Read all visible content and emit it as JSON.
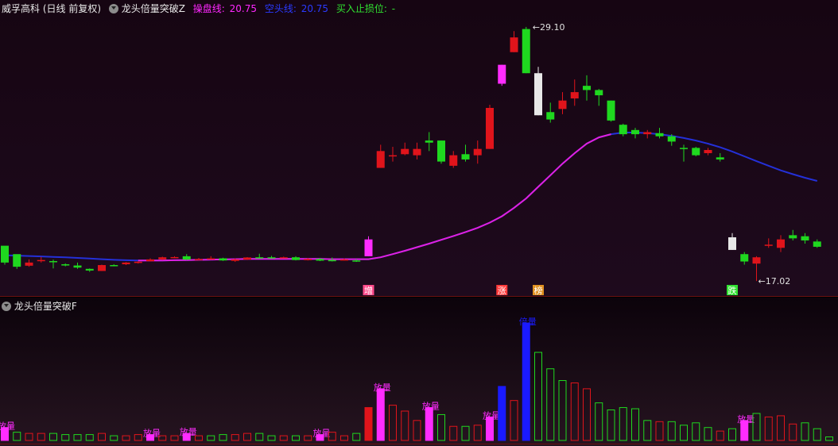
{
  "header": {
    "stock_name": "威孚高科",
    "period": "(日线 前复权)",
    "indicator_name": "龙头倍量突破Z",
    "control_label": "操盘线:",
    "control_value": "20.75",
    "empty_label": "空头线:",
    "empty_value": "20.75",
    "stop_label": "买入止损位:",
    "stop_value": "-"
  },
  "sub_header": {
    "indicator_name": "龙头倍量突破F"
  },
  "colors": {
    "up": "#e0141b",
    "down": "#1fd81f",
    "ma_blue": "#2430d8",
    "ma_magenta": "#e020e0",
    "special_magenta": "#ff2cff",
    "special_white": "#e8e8e8",
    "special_blue": "#1a1aff",
    "price_label": "#e0e0e0"
  },
  "chart_data": [
    {
      "type": "candlestick",
      "high_label": "29.10",
      "low_label": "17.02",
      "signals": [
        {
          "index": 30,
          "text": "增"
        },
        {
          "index": 41,
          "text": "涨"
        },
        {
          "index": 44,
          "text": "榜"
        },
        {
          "index": 60,
          "text": "跌"
        }
      ],
      "candles": [
        {
          "o": 17.9,
          "h": 18.2,
          "c": 18.7,
          "l": 17.8,
          "k": "g"
        },
        {
          "o": 17.7,
          "h": 18.1,
          "c": 18.3,
          "l": 17.6,
          "k": "g"
        },
        {
          "o": 17.9,
          "h": 18.05,
          "c": 17.75,
          "l": 17.7,
          "k": "r"
        },
        {
          "o": 17.97,
          "h": 18.17,
          "c": 18.02,
          "l": 17.9,
          "k": "r"
        },
        {
          "o": 17.92,
          "h": 18.04,
          "c": 17.97,
          "l": 17.62,
          "k": "g"
        },
        {
          "o": 17.76,
          "h": 17.86,
          "c": 17.82,
          "l": 17.72,
          "k": "g"
        },
        {
          "o": 17.76,
          "h": 17.9,
          "c": 17.66,
          "l": 17.6,
          "k": "g"
        },
        {
          "o": 17.6,
          "h": 17.62,
          "c": 17.52,
          "l": 17.46,
          "k": "g"
        },
        {
          "o": 17.5,
          "h": 17.8,
          "c": 17.78,
          "l": 17.5,
          "k": "r"
        },
        {
          "o": 17.78,
          "h": 17.82,
          "c": 17.75,
          "l": 17.72,
          "k": "g"
        },
        {
          "o": 17.82,
          "h": 17.92,
          "c": 17.9,
          "l": 17.78,
          "k": "r"
        },
        {
          "o": 17.88,
          "h": 17.96,
          "c": 17.94,
          "l": 17.85,
          "k": "r"
        },
        {
          "o": 17.96,
          "h": 18.1,
          "c": 18.05,
          "l": 17.95,
          "k": "r"
        },
        {
          "o": 18.05,
          "h": 18.18,
          "c": 18.15,
          "l": 18.02,
          "k": "r"
        },
        {
          "o": 18.14,
          "h": 18.2,
          "c": 18.16,
          "l": 18.1,
          "k": "r"
        },
        {
          "o": 18.2,
          "h": 18.3,
          "c": 18.04,
          "l": 18.02,
          "k": "g"
        },
        {
          "o": 18.05,
          "h": 18.12,
          "c": 18.07,
          "l": 18.0,
          "k": "r"
        },
        {
          "o": 18.06,
          "h": 18.2,
          "c": 18.1,
          "l": 18.03,
          "k": "r"
        },
        {
          "o": 18.1,
          "h": 18.13,
          "c": 18.0,
          "l": 17.98,
          "k": "g"
        },
        {
          "o": 17.98,
          "h": 18.1,
          "c": 18.05,
          "l": 17.93,
          "k": "r"
        },
        {
          "o": 18.04,
          "h": 18.16,
          "c": 18.14,
          "l": 18.02,
          "k": "r"
        },
        {
          "o": 18.15,
          "h": 18.32,
          "c": 18.12,
          "l": 18.1,
          "k": "g"
        },
        {
          "o": 18.14,
          "h": 18.22,
          "c": 18.15,
          "l": 18.1,
          "k": "g"
        },
        {
          "o": 18.15,
          "h": 18.18,
          "c": 18.13,
          "l": 18.1,
          "k": "r"
        },
        {
          "o": 18.15,
          "h": 18.2,
          "c": 18.02,
          "l": 18.0,
          "k": "g"
        },
        {
          "o": 18.05,
          "h": 18.12,
          "c": 18.07,
          "l": 18.0,
          "k": "r"
        },
        {
          "o": 18.07,
          "h": 18.12,
          "c": 17.99,
          "l": 17.97,
          "k": "g"
        },
        {
          "o": 18.0,
          "h": 18.14,
          "c": 18.02,
          "l": 17.95,
          "k": "g"
        },
        {
          "o": 18.04,
          "h": 18.1,
          "c": 18.05,
          "l": 18.0,
          "k": "r"
        },
        {
          "o": 18.0,
          "h": 18.06,
          "c": 17.95,
          "l": 17.93,
          "k": "g"
        },
        {
          "o": 18.2,
          "h": 19.15,
          "c": 19.0,
          "l": 18.2,
          "k": "m"
        },
        {
          "o": 22.4,
          "h": 23.5,
          "c": 23.2,
          "l": 22.4,
          "k": "r"
        },
        {
          "o": 23.0,
          "h": 23.4,
          "c": 22.95,
          "l": 22.7,
          "k": "r"
        },
        {
          "o": 23.05,
          "h": 23.6,
          "c": 23.3,
          "l": 23.0,
          "k": "r"
        },
        {
          "o": 23.0,
          "h": 23.6,
          "c": 23.3,
          "l": 22.8,
          "k": "r"
        },
        {
          "o": 23.7,
          "h": 24.1,
          "c": 23.6,
          "l": 23.2,
          "k": "g"
        },
        {
          "o": 23.7,
          "h": 23.7,
          "c": 22.7,
          "l": 22.6,
          "k": "g"
        },
        {
          "o": 22.5,
          "h": 23.2,
          "c": 23.0,
          "l": 22.4,
          "k": "r"
        },
        {
          "o": 23.05,
          "h": 23.5,
          "c": 22.8,
          "l": 22.7,
          "k": "g"
        },
        {
          "o": 23.0,
          "h": 23.7,
          "c": 23.3,
          "l": 22.6,
          "k": "r"
        },
        {
          "o": 23.3,
          "h": 25.4,
          "c": 25.25,
          "l": 23.3,
          "k": "r"
        },
        {
          "o": 26.4,
          "h": 27.3,
          "c": 27.3,
          "l": 26.3,
          "k": "m"
        },
        {
          "o": 27.9,
          "h": 28.9,
          "c": 28.6,
          "l": 27.9,
          "k": "r"
        },
        {
          "o": 29.0,
          "h": 29.1,
          "c": 26.9,
          "l": 26.9,
          "k": "g"
        },
        {
          "o": 26.9,
          "h": 27.2,
          "c": 24.9,
          "l": 24.9,
          "k": "w"
        },
        {
          "o": 25.05,
          "h": 25.5,
          "c": 24.7,
          "l": 24.55,
          "k": "g"
        },
        {
          "o": 25.2,
          "h": 26.0,
          "c": 25.6,
          "l": 24.95,
          "k": "r"
        },
        {
          "o": 25.7,
          "h": 26.6,
          "c": 26.0,
          "l": 25.35,
          "k": "r"
        },
        {
          "o": 26.3,
          "h": 26.8,
          "c": 26.1,
          "l": 25.6,
          "k": "g"
        },
        {
          "o": 26.1,
          "h": 26.15,
          "c": 25.85,
          "l": 25.35,
          "k": "g"
        },
        {
          "o": 25.6,
          "h": 25.6,
          "c": 24.65,
          "l": 24.6,
          "k": "g"
        },
        {
          "o": 24.45,
          "h": 24.5,
          "c": 24.0,
          "l": 23.9,
          "k": "g"
        },
        {
          "o": 24.2,
          "h": 24.3,
          "c": 24.0,
          "l": 23.8,
          "k": "g"
        },
        {
          "o": 24.0,
          "h": 24.2,
          "c": 24.1,
          "l": 23.8,
          "k": "r"
        },
        {
          "o": 24.05,
          "h": 24.3,
          "c": 23.9,
          "l": 23.8,
          "k": "g"
        },
        {
          "o": 23.9,
          "h": 24.0,
          "c": 23.65,
          "l": 23.45,
          "k": "g"
        },
        {
          "o": 23.35,
          "h": 23.5,
          "c": 23.3,
          "l": 22.7,
          "k": "g"
        },
        {
          "o": 23.35,
          "h": 23.4,
          "c": 23.0,
          "l": 22.95,
          "k": "g"
        },
        {
          "o": 23.1,
          "h": 23.35,
          "c": 23.25,
          "l": 23.0,
          "k": "r"
        },
        {
          "o": 22.9,
          "h": 23.1,
          "c": 22.8,
          "l": 22.7,
          "k": "g"
        },
        {
          "o": 19.1,
          "h": 19.3,
          "c": 18.5,
          "l": 18.5,
          "k": "w"
        },
        {
          "o": 18.3,
          "h": 18.4,
          "c": 17.95,
          "l": 17.8,
          "k": "g"
        },
        {
          "o": 17.85,
          "h": 18.2,
          "c": 18.15,
          "l": 17.02,
          "k": "r"
        },
        {
          "o": 18.7,
          "h": 19.05,
          "c": 18.75,
          "l": 18.6,
          "k": "r"
        },
        {
          "o": 18.6,
          "h": 19.2,
          "c": 19.0,
          "l": 18.4,
          "k": "r"
        },
        {
          "o": 19.2,
          "h": 19.45,
          "c": 19.05,
          "l": 18.95,
          "k": "g"
        },
        {
          "o": 19.15,
          "h": 19.3,
          "c": 18.95,
          "l": 18.8,
          "k": "g"
        },
        {
          "o": 18.9,
          "h": 19.0,
          "c": 18.65,
          "l": 18.6,
          "k": "g"
        }
      ],
      "ma_blue": [
        18.25,
        18.23,
        18.21,
        18.19,
        18.17,
        18.15,
        18.12,
        18.09,
        18.06,
        18.03,
        18.01,
        18.0,
        18.0,
        18.0,
        18.01,
        18.02,
        18.03,
        18.04,
        18.05,
        18.06,
        18.07,
        18.07,
        18.07,
        18.07,
        18.07,
        18.07,
        18.07,
        18.06,
        18.06,
        18.06,
        18.06,
        18.15,
        18.3,
        18.46,
        18.63,
        18.8,
        18.98,
        19.16,
        19.35,
        19.55,
        19.8,
        20.1,
        20.5,
        20.95,
        21.5,
        22.05,
        22.6,
        23.1,
        23.55,
        23.85,
        24.0,
        24.08,
        24.08,
        24.05,
        24.0,
        23.92,
        23.82,
        23.7,
        23.55,
        23.38,
        23.18,
        22.95,
        22.72,
        22.5,
        22.28,
        22.1,
        21.93,
        21.78
      ],
      "ma_magenta_start": 11,
      "ma_magenta_end": 50,
      "volume_max": 100,
      "volumes": [
        {
          "v": 11,
          "k": "m",
          "t": "放量"
        },
        {
          "v": 7,
          "k": "g"
        },
        {
          "v": 6,
          "k": "r"
        },
        {
          "v": 6,
          "k": "r"
        },
        {
          "v": 6,
          "k": "g"
        },
        {
          "v": 5,
          "k": "g"
        },
        {
          "v": 5,
          "k": "g"
        },
        {
          "v": 5,
          "k": "g"
        },
        {
          "v": 6,
          "k": "r"
        },
        {
          "v": 4,
          "k": "g"
        },
        {
          "v": 4,
          "k": "r"
        },
        {
          "v": 5,
          "k": "r"
        },
        {
          "v": 5,
          "k": "m",
          "t": "放量"
        },
        {
          "v": 4,
          "k": "r"
        },
        {
          "v": 4,
          "k": "r"
        },
        {
          "v": 6,
          "k": "m",
          "t": "放量"
        },
        {
          "v": 4,
          "k": "r"
        },
        {
          "v": 4,
          "k": "g"
        },
        {
          "v": 5,
          "k": "g"
        },
        {
          "v": 5,
          "k": "r"
        },
        {
          "v": 6,
          "k": "r"
        },
        {
          "v": 6,
          "k": "g"
        },
        {
          "v": 4,
          "k": "g"
        },
        {
          "v": 4,
          "k": "r"
        },
        {
          "v": 4,
          "k": "g"
        },
        {
          "v": 4,
          "k": "r"
        },
        {
          "v": 5,
          "k": "m",
          "t": "放量"
        },
        {
          "v": 7,
          "k": "r"
        },
        {
          "v": 4,
          "k": "r"
        },
        {
          "v": 6,
          "k": "g"
        },
        {
          "v": 28,
          "k": "r_filled"
        },
        {
          "v": 44,
          "k": "m",
          "t": "放量"
        },
        {
          "v": 30,
          "k": "r"
        },
        {
          "v": 25,
          "k": "r"
        },
        {
          "v": 17,
          "k": "r"
        },
        {
          "v": 28,
          "k": "m",
          "t": "放量"
        },
        {
          "v": 22,
          "k": "g"
        },
        {
          "v": 12,
          "k": "r"
        },
        {
          "v": 12,
          "k": "g"
        },
        {
          "v": 13,
          "k": "r"
        },
        {
          "v": 20,
          "k": "m",
          "t": "放量"
        },
        {
          "v": 46,
          "k": "b"
        },
        {
          "v": 34,
          "k": "r"
        },
        {
          "v": 100,
          "k": "b",
          "t": "倍量"
        },
        {
          "v": 75,
          "k": "g"
        },
        {
          "v": 61,
          "k": "g"
        },
        {
          "v": 51,
          "k": "g"
        },
        {
          "v": 49,
          "k": "r"
        },
        {
          "v": 44,
          "k": "r"
        },
        {
          "v": 32,
          "k": "g"
        },
        {
          "v": 26,
          "k": "g"
        },
        {
          "v": 28,
          "k": "g"
        },
        {
          "v": 27,
          "k": "g"
        },
        {
          "v": 17,
          "k": "g"
        },
        {
          "v": 16,
          "k": "r"
        },
        {
          "v": 16,
          "k": "g"
        },
        {
          "v": 13,
          "k": "g"
        },
        {
          "v": 15,
          "k": "g"
        },
        {
          "v": 11,
          "k": "g"
        },
        {
          "v": 8,
          "k": "r"
        },
        {
          "v": 10,
          "k": "g"
        },
        {
          "v": 17,
          "k": "m",
          "t": "放量"
        },
        {
          "v": 23,
          "k": "g"
        },
        {
          "v": 20,
          "k": "r"
        },
        {
          "v": 21,
          "k": "r"
        },
        {
          "v": 14,
          "k": "r"
        },
        {
          "v": 15,
          "k": "g"
        },
        {
          "v": 10,
          "k": "g"
        },
        {
          "v": 3,
          "k": "g"
        }
      ]
    }
  ]
}
